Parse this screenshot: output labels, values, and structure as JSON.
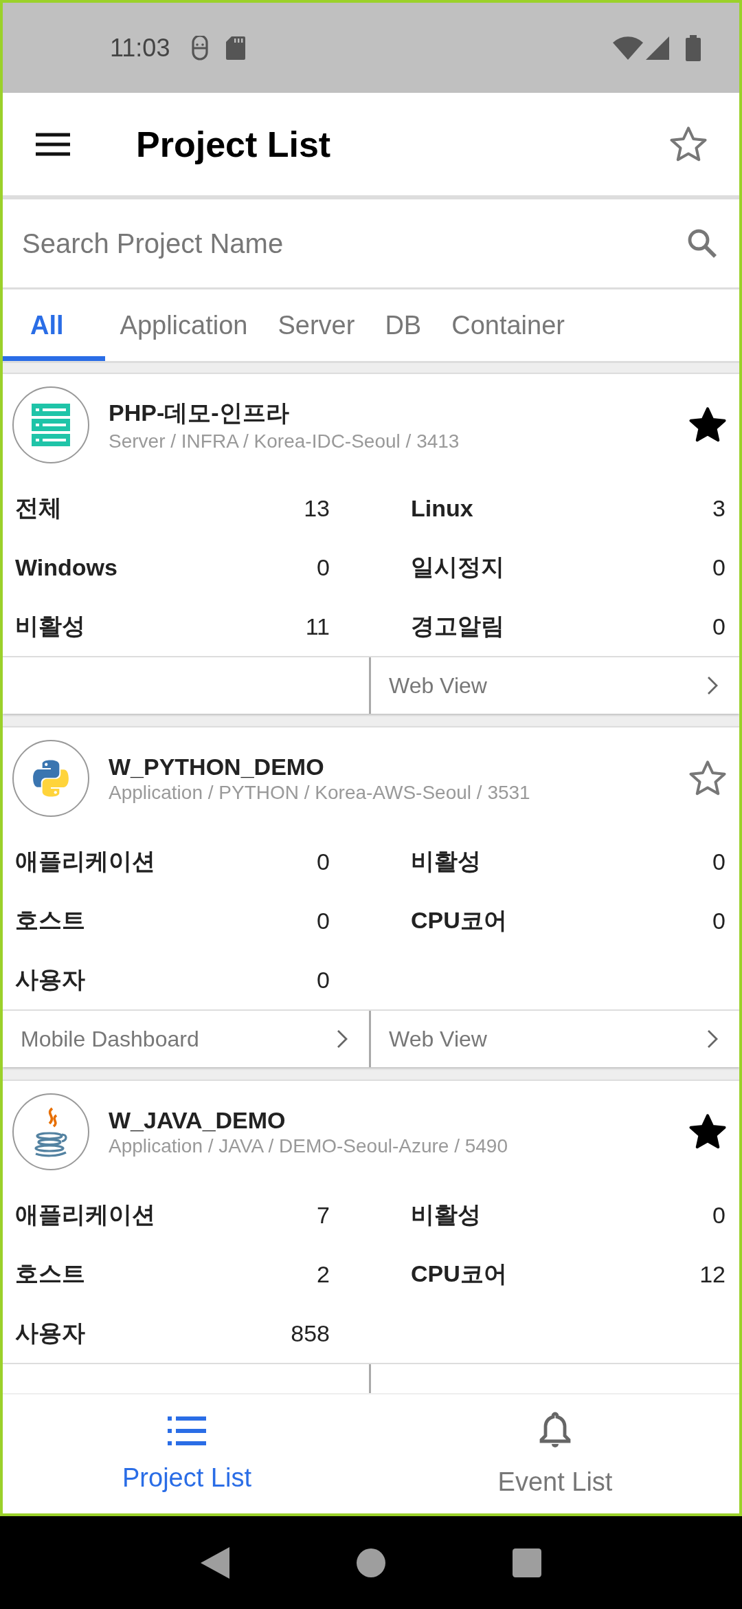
{
  "status_bar": {
    "time": "11:03"
  },
  "app_bar": {
    "title": "Project List",
    "favorite": false
  },
  "search": {
    "placeholder": "Search Project Name"
  },
  "tabs": [
    {
      "label": "All",
      "selected": true
    },
    {
      "label": "Application",
      "selected": false
    },
    {
      "label": "Server",
      "selected": false
    },
    {
      "label": "DB",
      "selected": false
    },
    {
      "label": "Container",
      "selected": false
    }
  ],
  "projects": [
    {
      "name": "PHP-데모-인프라",
      "kind": "server",
      "details": "Server / INFRA / Korea-IDC-Seoul / 3413",
      "favorite": true,
      "stats": [
        {
          "label": "전체",
          "value": "13"
        },
        {
          "label": "Linux",
          "value": "3"
        },
        {
          "label": "Windows",
          "value": "0"
        },
        {
          "label": "일시정지",
          "value": "0"
        },
        {
          "label": "비활성",
          "value": "11"
        },
        {
          "label": "경고알림",
          "value": "0"
        }
      ],
      "right_link": "Web View"
    },
    {
      "name": "W_PYTHON_DEMO",
      "kind": "python",
      "details": "Application / PYTHON / Korea-AWS-Seoul / 3531",
      "favorite": false,
      "stats": [
        {
          "label": "애플리케이션",
          "value": "0"
        },
        {
          "label": "비활성",
          "value": "0"
        },
        {
          "label": "호스트",
          "value": "0"
        },
        {
          "label": "CPU코어",
          "value": "0"
        },
        {
          "label": "사용자",
          "value": "0"
        }
      ],
      "left_link": "Mobile Dashboard",
      "right_link": "Web View"
    },
    {
      "name": "W_JAVA_DEMO",
      "kind": "java",
      "details": "Application / JAVA / DEMO-Seoul-Azure / 5490",
      "favorite": true,
      "stats": [
        {
          "label": "애플리케이션",
          "value": "7"
        },
        {
          "label": "비활성",
          "value": "0"
        },
        {
          "label": "호스트",
          "value": "2"
        },
        {
          "label": "CPU코어",
          "value": "12"
        },
        {
          "label": "사용자",
          "value": "858"
        }
      ]
    }
  ],
  "bottom_nav": [
    {
      "label": "Project List",
      "kind": "list",
      "selected": true
    },
    {
      "label": "Event List",
      "kind": "bell",
      "selected": false
    }
  ]
}
